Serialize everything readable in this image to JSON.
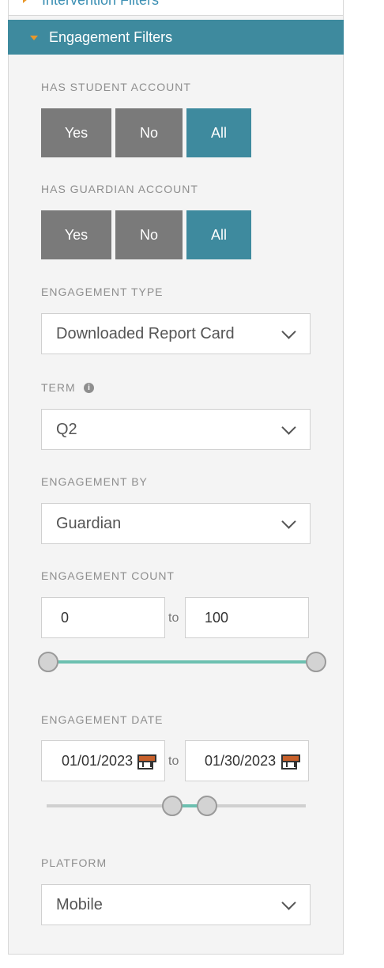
{
  "intervention_filters": {
    "title": "Intervention Filters"
  },
  "engagement_filters": {
    "title": "Engagement Filters",
    "has_student_account": {
      "label": "HAS STUDENT ACCOUNT",
      "options": [
        "Yes",
        "No",
        "All"
      ],
      "selected": "All"
    },
    "has_guardian_account": {
      "label": "HAS GUARDIAN ACCOUNT",
      "options": [
        "Yes",
        "No",
        "All"
      ],
      "selected": "All"
    },
    "engagement_type": {
      "label": "ENGAGEMENT TYPE",
      "value": "Downloaded Report Card"
    },
    "term": {
      "label": "TERM",
      "value": "Q2"
    },
    "engagement_by": {
      "label": "ENGAGEMENT BY",
      "value": "Guardian"
    },
    "engagement_count": {
      "label": "ENGAGEMENT COUNT",
      "min": "0",
      "max": "100",
      "to": "to"
    },
    "engagement_date": {
      "label": "ENGAGEMENT DATE",
      "from": "01/01/2023",
      "to_value": "01/30/2023",
      "to": "to"
    },
    "platform": {
      "label": "PLATFORM",
      "value": "Mobile"
    }
  },
  "colors": {
    "accent": "#3e8a9e",
    "inactive_segment": "#7a7a7a",
    "slider_fill": "#6cc0b0",
    "caret": "#e8972a"
  }
}
